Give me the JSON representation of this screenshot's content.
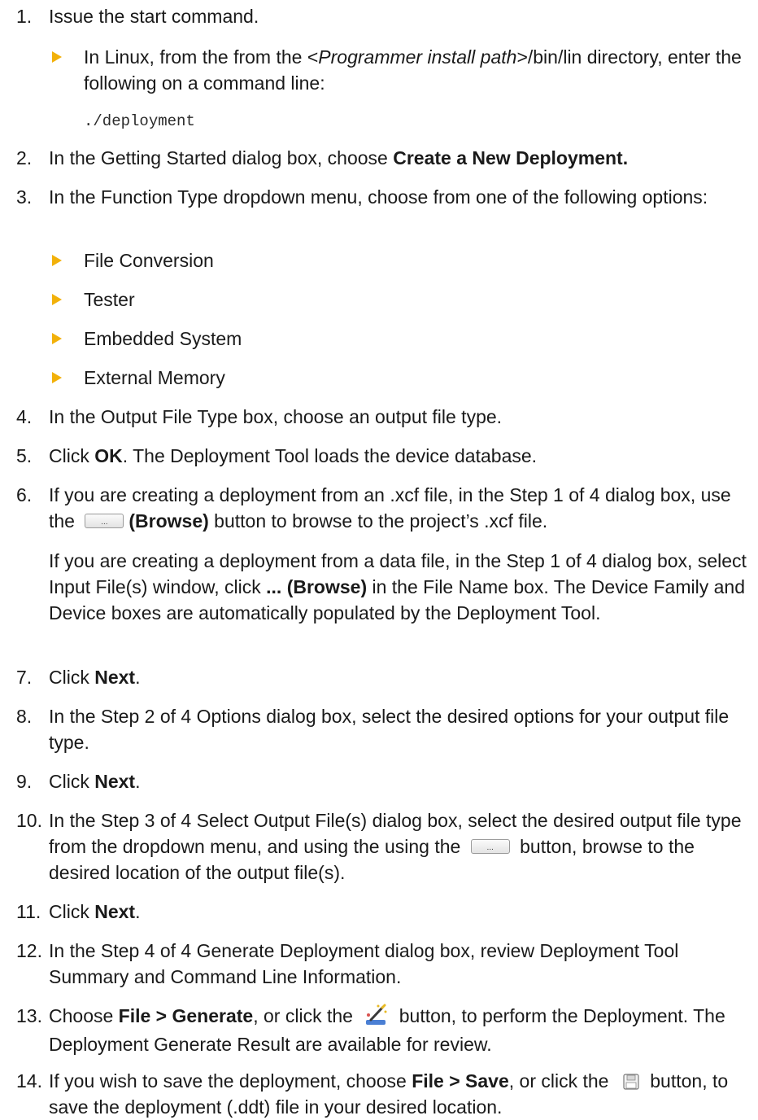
{
  "steps": [
    {
      "num": "1.",
      "text": "Issue the start command."
    },
    {
      "num": "2.",
      "pre": "In the Getting Started dialog box, choose ",
      "bold": "Create a New Deployment."
    },
    {
      "num": "3.",
      "text": "In the Function Type dropdown menu, choose from one of the following options:"
    },
    {
      "num": "4.",
      "text": "In the Output File Type box, choose an output file type."
    },
    {
      "num": "5.",
      "pre": "Click ",
      "bold": "OK",
      "post": ". The Deployment Tool loads the device database."
    },
    {
      "num": "6.",
      "pre": "If you are creating a deployment from an .xcf file, in the Step 1 of 4 dialog box, use the ",
      "bold": "(Browse)",
      "post": " button to browse to the project’s .xcf file."
    },
    {
      "num": "7.",
      "pre": "Click ",
      "bold": "Next",
      "post": "."
    },
    {
      "num": "8.",
      "text": "In the Step 2 of 4 Options dialog box, select the desired options for your output file type."
    },
    {
      "num": "9.",
      "pre": "Click ",
      "bold": "Next",
      "post": "."
    },
    {
      "num": "10.",
      "pre": "In the Step 3 of 4 Select Output File(s) dialog box, select the desired output file type from the dropdown menu, and using the using the ",
      "post": " button, browse to the desired location of the output file(s)."
    },
    {
      "num": "11.",
      "pre": "Click ",
      "bold": "Next",
      "post": "."
    },
    {
      "num": "12.",
      "text": "In the Step 4 of 4 Generate Deployment dialog box, review Deployment Tool Summary and Command Line Information."
    },
    {
      "num": "13.",
      "pre": "Choose ",
      "bold": "File > Generate",
      "mid": ", or click the ",
      "post": " button, to perform the Deployment. The Deployment Generate Result are available for review."
    },
    {
      "num": "14.",
      "pre": "If you wish to save the deployment, choose ",
      "bold": "File > Save",
      "mid": ", or click the ",
      "post": " button, to save the deployment (.ddt) file in your desired location."
    }
  ],
  "linux_bullet": {
    "pre": "In Linux, from the from the <",
    "italic": "Programmer install path",
    "post": ">/bin/lin directory, enter the following on a command line:"
  },
  "command": "./deployment",
  "function_types": [
    "File Conversion",
    "Tester",
    "Embedded System",
    "External Memory"
  ],
  "data_file_para": {
    "pre": "If you are creating a deployment from a data file, in the Step 1 of 4 dialog box, select Input File(s) window, click ",
    "bold": "... (Browse)",
    "post": " in the File Name box. The Device Family and Device boxes are automatically populated by the Deployment Tool."
  },
  "browse_button_glyph": "...",
  "icons": {
    "bullet": "triangle-bullet-icon",
    "generate": "generate-wand-icon",
    "save": "floppy-disk-icon",
    "browse": "browse-ellipsis-icon"
  },
  "colors": {
    "bullet": "#f2b10a",
    "text": "#1a1a1a"
  }
}
